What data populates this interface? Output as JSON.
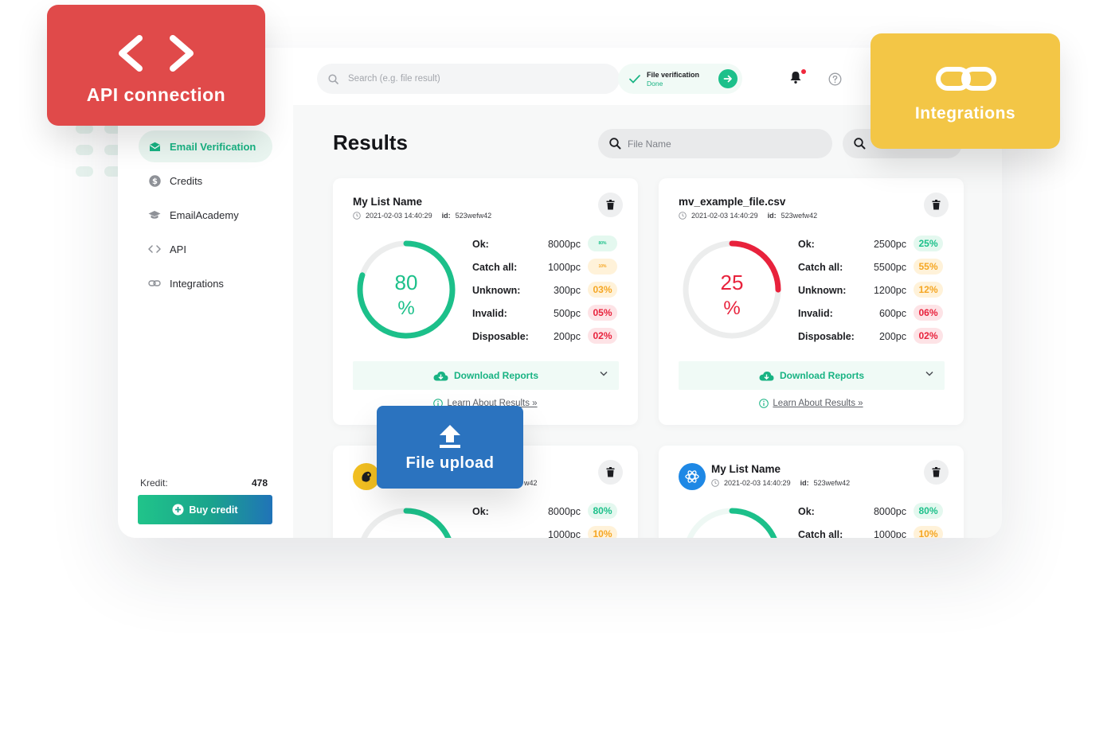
{
  "sidebar": {
    "items": [
      {
        "label": "Email Verification",
        "icon": "envelope-icon"
      },
      {
        "label": "Credits",
        "icon": "dollar-icon"
      },
      {
        "label": "EmailAcademy",
        "icon": "graduation-cap-icon"
      },
      {
        "label": "API",
        "icon": "code-icon"
      },
      {
        "label": "Integrations",
        "icon": "link-icon"
      }
    ],
    "kredit_label": "Kredit:",
    "kredit_value": "478",
    "buy_label": "Buy credit"
  },
  "topbar": {
    "search_placeholder": "Search (e.g. file result)",
    "verify_title": "File verification",
    "verify_status": "Done"
  },
  "main": {
    "title": "Results",
    "file_search_placeholder": "File Name"
  },
  "cards": [
    {
      "name": "My List Name",
      "date": "2021-02-03 14:40:29",
      "id_label": "id:",
      "id": "523wefw42",
      "percent": "80",
      "percent_sign": "%",
      "percent_value": 80,
      "ring_color": "#1cc08a",
      "stats": [
        {
          "label": "Ok:",
          "value": "8000pc",
          "pct": "80%"
        },
        {
          "label": "Catch all:",
          "value": "1000pc",
          "pct": "10%"
        },
        {
          "label": "Unknown:",
          "value": "300pc",
          "pct": "03%"
        },
        {
          "label": "Invalid:",
          "value": "500pc",
          "pct": "05%"
        },
        {
          "label": "Disposable:",
          "value": "200pc",
          "pct": "02%"
        }
      ],
      "download_label": "Download Reports",
      "learn_label": "Learn About Results »"
    },
    {
      "name": "mv_example_file.csv",
      "date": "2021-02-03 14:40:29",
      "id_label": "id:",
      "id": "523wefw42",
      "percent": "25",
      "percent_sign": "%",
      "percent_value": 25,
      "ring_color": "#e8223c",
      "stats": [
        {
          "label": "Ok:",
          "value": "2500pc",
          "pct": "25%"
        },
        {
          "label": "Catch all:",
          "value": "5500pc",
          "pct": "55%"
        },
        {
          "label": "Unknown:",
          "value": "1200pc",
          "pct": "12%"
        },
        {
          "label": "Invalid:",
          "value": "600pc",
          "pct": "06%"
        },
        {
          "label": "Disposable:",
          "value": "200pc",
          "pct": "02%"
        }
      ],
      "download_label": "Download Reports",
      "learn_label": "Learn About Results »"
    },
    {
      "id_fragment": "w42",
      "percent_value": 80,
      "ring_color": "#1cc08a",
      "stats": [
        {
          "label": "Ok:",
          "value": "8000pc",
          "pct": "80%"
        },
        {
          "label": "",
          "value": "1000pc",
          "pct": "10%"
        }
      ]
    },
    {
      "name": "My List Name",
      "date": "2021-02-03 14:40:29",
      "id_label": "id:",
      "id": "523wefw42",
      "percent_value": 25,
      "ring_color": "#1cc08a",
      "stats": [
        {
          "label": "Ok:",
          "value": "8000pc",
          "pct": "80%"
        },
        {
          "label": "Catch all:",
          "value": "1000pc",
          "pct": "10%"
        }
      ]
    }
  ],
  "overlays": {
    "api": "API connection",
    "integrations": "Integrations",
    "upload": "File upload"
  },
  "colors": {
    "accent_green": "#1cc08a",
    "accent_red": "#e8223c",
    "accent_orange": "#f5a623",
    "api_card": "#e04a4a",
    "integrations_card": "#f3c646",
    "upload_card": "#2b73bf"
  }
}
